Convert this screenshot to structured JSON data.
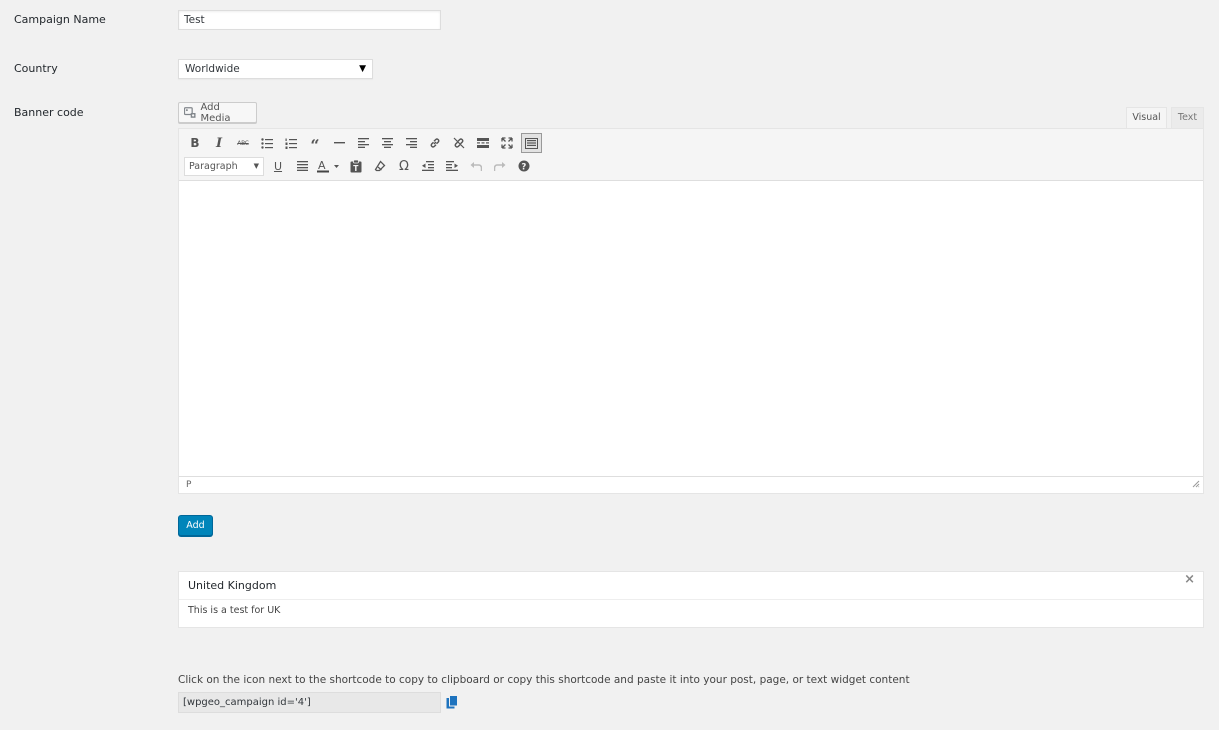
{
  "form": {
    "campaign_name_label": "Campaign Name",
    "campaign_name_value": "Test",
    "country_label": "Country",
    "country_selected": "Worldwide",
    "banner_code_label": "Banner code"
  },
  "editor": {
    "add_media_label": "Add Media",
    "tabs": [
      {
        "label": "Visual",
        "active": true
      },
      {
        "label": "Text",
        "active": false
      }
    ],
    "toolbar_row1": [
      {
        "name": "bold-icon",
        "glyph": "B"
      },
      {
        "name": "italic-icon",
        "glyph": "I"
      },
      {
        "name": "strikethrough-icon",
        "glyph": "ABC"
      },
      {
        "name": "bulleted-list-icon",
        "glyph": "list-ul"
      },
      {
        "name": "numbered-list-icon",
        "glyph": "list-ol"
      },
      {
        "name": "blockquote-icon",
        "glyph": "quote"
      },
      {
        "name": "horizontal-line-icon",
        "glyph": "hr"
      },
      {
        "name": "align-left-icon",
        "glyph": "align-left"
      },
      {
        "name": "align-center-icon",
        "glyph": "align-center"
      },
      {
        "name": "align-right-icon",
        "glyph": "align-right"
      },
      {
        "name": "insert-link-icon",
        "glyph": "link"
      },
      {
        "name": "remove-link-icon",
        "glyph": "unlink"
      },
      {
        "name": "read-more-icon",
        "glyph": "more"
      },
      {
        "name": "fullscreen-icon",
        "glyph": "fullscreen"
      },
      {
        "name": "toolbar-toggle-icon",
        "glyph": "kitchen-sink"
      }
    ],
    "paragraph_format": "Paragraph",
    "toolbar_row2": [
      {
        "name": "underline-icon",
        "glyph": "U"
      },
      {
        "name": "justify-icon",
        "glyph": "justify"
      },
      {
        "name": "text-color-icon",
        "glyph": "A"
      },
      {
        "name": "paste-as-text-icon",
        "glyph": "paste"
      },
      {
        "name": "clear-formatting-icon",
        "glyph": "eraser"
      },
      {
        "name": "special-character-icon",
        "glyph": "Ω"
      },
      {
        "name": "decrease-indent-icon",
        "glyph": "outdent"
      },
      {
        "name": "increase-indent-icon",
        "glyph": "indent"
      },
      {
        "name": "undo-icon",
        "glyph": "undo"
      },
      {
        "name": "redo-icon",
        "glyph": "redo"
      },
      {
        "name": "help-icon",
        "glyph": "?"
      }
    ],
    "status_path": "P"
  },
  "actions": {
    "add_button_label": "Add"
  },
  "campaign_entry": {
    "country": "United Kingdom",
    "content": "This is a test for UK"
  },
  "shortcode": {
    "instructions": "Click on the icon next to the shortcode to copy to clipboard or copy this shortcode and paste it into your post, page, or text widget content",
    "value": "[wpgeo_campaign id='4']"
  },
  "colors": {
    "primary": "#0085ba",
    "background": "#f1f1f1"
  }
}
